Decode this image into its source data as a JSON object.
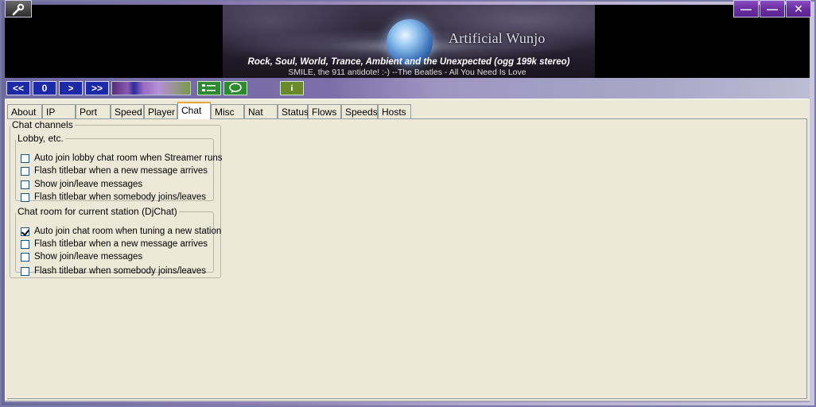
{
  "window": {
    "tool_icon": "wrench-icon",
    "minimize_label": "—",
    "maximize_label": "—",
    "close_label": "✕"
  },
  "banner": {
    "brand": "Artificial Wunjo",
    "line1": "Rock, Soul, World, Trance, Ambient and the  Unexpected  (ogg 199k stereo)",
    "line2": "SMILE, the 911 antidote! :-)  --The Beatles - All You Need Is Love"
  },
  "toolbar": {
    "prev_label": "<<",
    "zero_label": "0",
    "next_label": ">",
    "fwd_label": ">>",
    "list_icon": "list-icon",
    "chat_icon": "chat-bubble-icon",
    "info_label": "i"
  },
  "tabs": [
    {
      "label": "About"
    },
    {
      "label": "IP"
    },
    {
      "label": "Port"
    },
    {
      "label": "Speed"
    },
    {
      "label": "Player"
    },
    {
      "label": "Chat",
      "active": true
    },
    {
      "label": "Misc"
    },
    {
      "label": "Nat"
    },
    {
      "label": "Status"
    },
    {
      "label": "Flows"
    },
    {
      "label": "Speeds"
    },
    {
      "label": "Hosts"
    }
  ],
  "chat": {
    "channels_title": "Chat channels",
    "lobby": {
      "title": "Lobby, etc.",
      "options": [
        {
          "label": "Auto join lobby chat room when Streamer runs",
          "checked": false
        },
        {
          "label": "Flash titlebar when a new message arrives",
          "checked": false
        },
        {
          "label": "Show join/leave messages",
          "checked": false
        },
        {
          "label": "Flash titlebar when somebody joins/leaves",
          "checked": false
        }
      ]
    },
    "station": {
      "title": "Chat room for current station (DjChat)",
      "options": [
        {
          "label": "Auto join chat room when tuning a new station",
          "checked": true
        },
        {
          "label": "Flash titlebar when a new message arrives",
          "checked": false
        },
        {
          "label": "Show join/leave messages",
          "checked": false
        },
        {
          "label": "Flash titlebar when somebody joins/leaves",
          "checked": false
        }
      ]
    }
  }
}
